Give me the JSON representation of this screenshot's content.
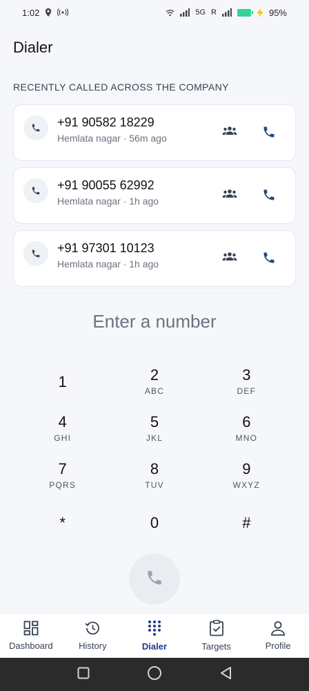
{
  "status_bar": {
    "time": "1:02",
    "network": "5G",
    "roaming": "R",
    "battery_percent": "95%"
  },
  "page_title": "Dialer",
  "recent": {
    "section_label": "RECENTLY CALLED ACROSS THE COMPANY",
    "items": [
      {
        "number": "+91 90582 18229",
        "subtitle": "Hemlata nagar · 56m ago"
      },
      {
        "number": "+91 90055 62992",
        "subtitle": "Hemlata nagar · 1h ago"
      },
      {
        "number": "+91 97301 10123",
        "subtitle": "Hemlata nagar · 1h ago"
      }
    ]
  },
  "number_input": {
    "placeholder": "Enter a number"
  },
  "keypad": [
    [
      {
        "digit": "1",
        "letters": ""
      },
      {
        "digit": "2",
        "letters": "ABC"
      },
      {
        "digit": "3",
        "letters": "DEF"
      }
    ],
    [
      {
        "digit": "4",
        "letters": "GHI"
      },
      {
        "digit": "5",
        "letters": "JKL"
      },
      {
        "digit": "6",
        "letters": "MNO"
      }
    ],
    [
      {
        "digit": "7",
        "letters": "PQRS"
      },
      {
        "digit": "8",
        "letters": "TUV"
      },
      {
        "digit": "9",
        "letters": "WXYZ"
      }
    ],
    [
      {
        "digit": "*",
        "letters": ""
      },
      {
        "digit": "0",
        "letters": ""
      },
      {
        "digit": "#",
        "letters": ""
      }
    ]
  ],
  "bottom_nav": {
    "items": [
      {
        "label": "Dashboard",
        "icon": "dashboard-icon"
      },
      {
        "label": "History",
        "icon": "history-icon"
      },
      {
        "label": "Dialer",
        "icon": "dialpad-icon",
        "active": true
      },
      {
        "label": "Targets",
        "icon": "clipboard-check-icon"
      },
      {
        "label": "Profile",
        "icon": "person-icon"
      }
    ]
  },
  "colors": {
    "accent": "#1e3a8a",
    "call_icon": "#1e4a80",
    "background": "#f5f7fa",
    "battery": "#34d399"
  }
}
